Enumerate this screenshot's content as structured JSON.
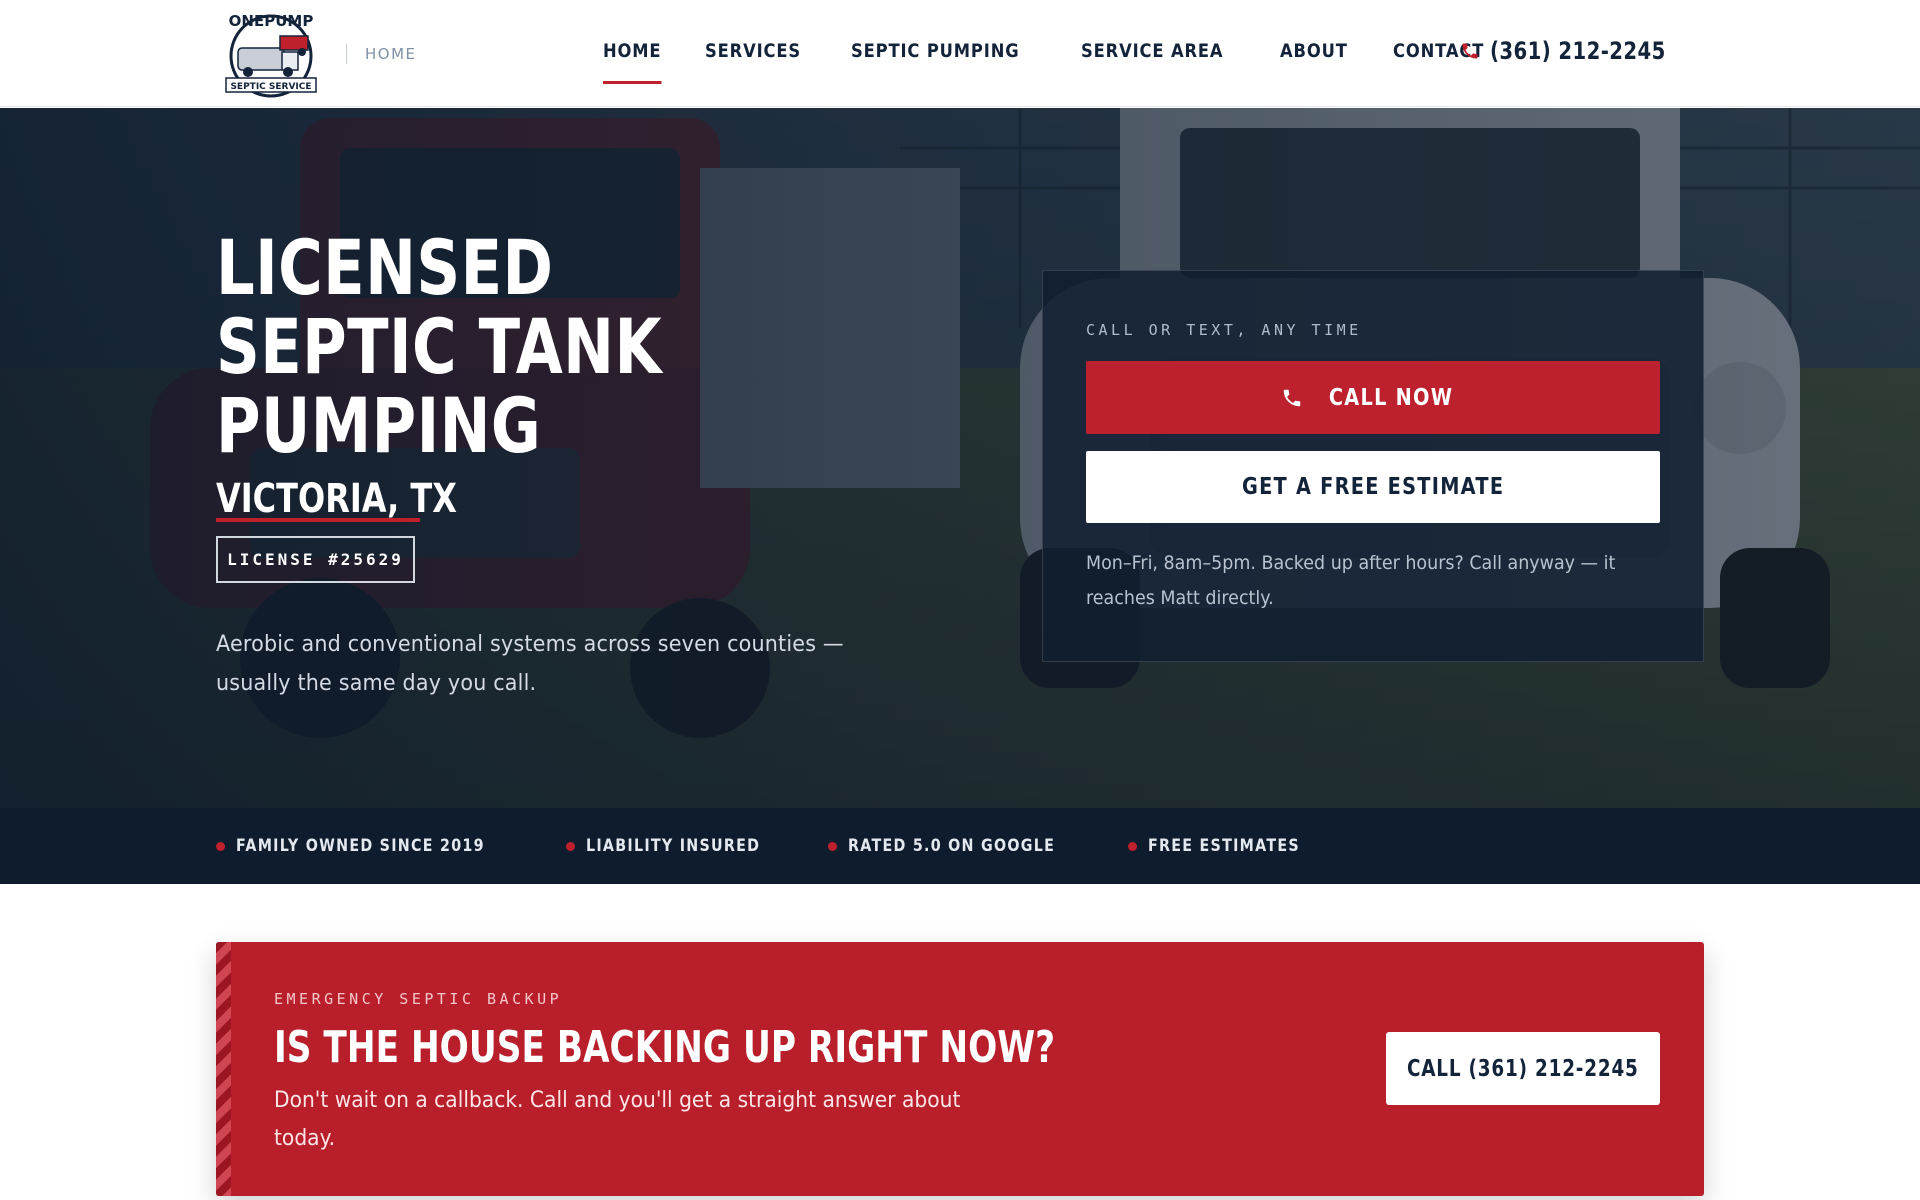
{
  "header": {
    "logo_text_top": "ONEPUMP",
    "logo_text_bottom": "SEPTIC SERVICE",
    "breadcrumb": "HOME",
    "nav": [
      {
        "label": "HOME",
        "active": true
      },
      {
        "label": "SERVICES",
        "active": false
      },
      {
        "label": "SEPTIC PUMPING",
        "active": false
      },
      {
        "label": "SERVICE AREA",
        "active": false
      },
      {
        "label": "ABOUT",
        "active": false
      },
      {
        "label": "CONTACT",
        "active": false
      }
    ],
    "phone": "(361) 212-2245",
    "phone_icon": "phone-icon"
  },
  "hero": {
    "title_lines": [
      "LICENSED",
      "SEPTIC TANK",
      "PUMPING"
    ],
    "city": "VICTORIA, TX",
    "license": "LICENSE #25629",
    "description_lines": [
      "Aerobic and conventional systems across seven counties —",
      "usually the same day you call."
    ],
    "background": "septic pumping trucks photo"
  },
  "cta": {
    "eyebrow": "CALL OR TEXT, ANY TIME",
    "call_label": "CALL NOW",
    "estimate_label": "GET A FREE ESTIMATE",
    "note_lines": [
      "Mon–Fri, 8am–5pm. Backed up after hours? Call anyway — it",
      "reaches Matt directly."
    ]
  },
  "trust": [
    "FAMILY OWNED SINCE 2019",
    "LIABILITY INSURED",
    "RATED 5.0 ON GOOGLE",
    "FREE ESTIMATES"
  ],
  "emergency": {
    "eyebrow": "EMERGENCY SEPTIC BACKUP",
    "title": "IS THE HOUSE BACKING UP RIGHT NOW?",
    "description_lines": [
      "Don't wait on a callback. Call and you'll get a straight answer about",
      "today."
    ],
    "button_label": "CALL (361) 212-2245"
  },
  "colors": {
    "brand_red": "#bd212d",
    "navy": "#13233a",
    "dark_navy": "#0e1c2e"
  }
}
